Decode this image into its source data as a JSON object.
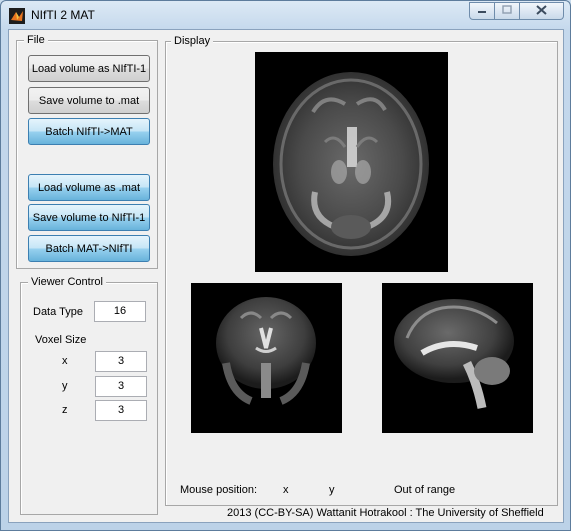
{
  "window": {
    "title": "NIfTI 2 MAT",
    "icon": "matlab-icon",
    "controls": {
      "minimize": "minimize-icon",
      "maximize": "maximize-icon",
      "close": "close-icon"
    }
  },
  "file_panel": {
    "title": "File",
    "buttons": {
      "load_nifti": "Load volume as NIfTI-1",
      "save_mat": "Save volume to .mat",
      "batch_nifti_mat": "Batch NIfTI->MAT",
      "load_mat": "Load volume as .mat",
      "save_nifti": "Save volume to NIfTI-1",
      "batch_mat_nifti": "Batch MAT->NIfTI"
    }
  },
  "viewer_control": {
    "title": "Viewer Control",
    "data_type_label": "Data Type",
    "data_type_value": "16",
    "voxel_size_label": "Voxel Size",
    "x_label": "x",
    "x_value": "3",
    "y_label": "y",
    "y_value": "3",
    "z_label": "z",
    "z_value": "3"
  },
  "display_panel": {
    "title": "Display",
    "mouse_position_label": "Mouse position:",
    "mouse_x_label": "x",
    "mouse_y_label": "y",
    "mouse_status": "Out of range"
  },
  "footer": {
    "credit": "2013 (CC-BY-SA)  Wattanit Hotrakool : The University of Sheffield"
  }
}
